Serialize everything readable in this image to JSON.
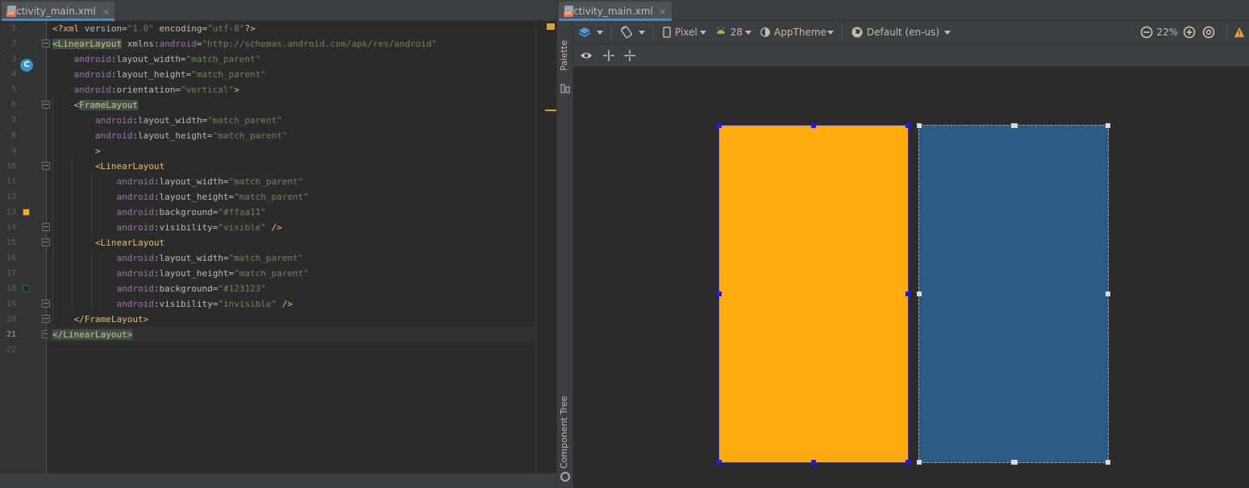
{
  "editor": {
    "tab_label": "activity_main.xml",
    "tab_close": "×",
    "file_icon_tag": "xml",
    "gutter_icon": "C",
    "line_numbers": [
      "1",
      "2",
      "3",
      "4",
      "5",
      "6",
      "7",
      "8",
      "9",
      "10",
      "11",
      "12",
      "13",
      "14",
      "15",
      "16",
      "17",
      "18",
      "19",
      "20",
      "21",
      "22"
    ],
    "current_line": 21,
    "swatch_colors": {
      "line13": "#ffaa11",
      "line18": "#123123"
    },
    "lines": [
      [
        {
          "t": "<?xml ",
          "c": "pi"
        },
        {
          "t": "version=",
          "c": "attr"
        },
        {
          "t": "\"1.0\"",
          "c": "val"
        },
        {
          "t": " encoding=",
          "c": "attr"
        },
        {
          "t": "\"utf-8\"",
          "c": "val"
        },
        {
          "t": "?>",
          "c": "pi"
        }
      ],
      [
        {
          "t": "<LinearLayout",
          "c": "tag",
          "hl": true
        },
        {
          "t": " xmlns:",
          "c": "attr"
        },
        {
          "t": "android",
          "c": "ns"
        },
        {
          "t": "=",
          "c": "attr"
        },
        {
          "t": "\"http://schemas.android.com/apk/res/android\"",
          "c": "val"
        }
      ],
      [
        {
          "t": "    ",
          "c": "attr"
        },
        {
          "t": "android",
          "c": "ns"
        },
        {
          "t": ":layout_width=",
          "c": "attr"
        },
        {
          "t": "\"match_parent\"",
          "c": "val"
        }
      ],
      [
        {
          "t": "    ",
          "c": "attr"
        },
        {
          "t": "android",
          "c": "ns"
        },
        {
          "t": ":layout_height=",
          "c": "attr"
        },
        {
          "t": "\"match_parent\"",
          "c": "val"
        }
      ],
      [
        {
          "t": "    ",
          "c": "attr"
        },
        {
          "t": "android",
          "c": "ns"
        },
        {
          "t": ":orientation=",
          "c": "attr"
        },
        {
          "t": "\"vertical\"",
          "c": "val"
        },
        {
          "t": ">",
          "c": "tag"
        }
      ],
      [
        {
          "t": "    ",
          "c": "attr"
        },
        {
          "t": "<",
          "c": "tag"
        },
        {
          "t": "FrameLayout",
          "c": "tag",
          "hl": true
        }
      ],
      [
        {
          "t": "        ",
          "c": "attr"
        },
        {
          "t": "android",
          "c": "ns"
        },
        {
          "t": ":layout_width=",
          "c": "attr"
        },
        {
          "t": "\"match_parent\"",
          "c": "val"
        }
      ],
      [
        {
          "t": "        ",
          "c": "attr"
        },
        {
          "t": "android",
          "c": "ns"
        },
        {
          "t": ":layout_height=",
          "c": "attr"
        },
        {
          "t": "\"match_parent\"",
          "c": "val"
        }
      ],
      [
        {
          "t": "        ",
          "c": "attr"
        },
        {
          "t": ">",
          "c": "tag"
        }
      ],
      [
        {
          "t": "        ",
          "c": "attr"
        },
        {
          "t": "<LinearLayout",
          "c": "tag"
        }
      ],
      [
        {
          "t": "            ",
          "c": "attr"
        },
        {
          "t": "android",
          "c": "ns"
        },
        {
          "t": ":layout_width=",
          "c": "attr"
        },
        {
          "t": "\"match_parent\"",
          "c": "val"
        }
      ],
      [
        {
          "t": "            ",
          "c": "attr"
        },
        {
          "t": "android",
          "c": "ns"
        },
        {
          "t": ":layout_height=",
          "c": "attr"
        },
        {
          "t": "\"match_parent\"",
          "c": "val"
        }
      ],
      [
        {
          "t": "            ",
          "c": "attr"
        },
        {
          "t": "android",
          "c": "ns"
        },
        {
          "t": ":background=",
          "c": "attr"
        },
        {
          "t": "\"#ffaa11\"",
          "c": "val"
        }
      ],
      [
        {
          "t": "            ",
          "c": "attr"
        },
        {
          "t": "android",
          "c": "ns"
        },
        {
          "t": ":visibility=",
          "c": "attr"
        },
        {
          "t": "\"visible\"",
          "c": "val"
        },
        {
          "t": " />",
          "c": "tag"
        }
      ],
      [
        {
          "t": "        ",
          "c": "attr"
        },
        {
          "t": "<LinearLayout",
          "c": "tag"
        }
      ],
      [
        {
          "t": "            ",
          "c": "attr"
        },
        {
          "t": "android",
          "c": "ns"
        },
        {
          "t": ":layout_width=",
          "c": "attr"
        },
        {
          "t": "\"match_parent\"",
          "c": "val"
        }
      ],
      [
        {
          "t": "            ",
          "c": "attr"
        },
        {
          "t": "android",
          "c": "ns"
        },
        {
          "t": ":layout_height=",
          "c": "attr"
        },
        {
          "t": "\"match_parent\"",
          "c": "val"
        }
      ],
      [
        {
          "t": "            ",
          "c": "attr"
        },
        {
          "t": "android",
          "c": "ns"
        },
        {
          "t": ":background=",
          "c": "attr"
        },
        {
          "t": "\"#123123\"",
          "c": "val"
        }
      ],
      [
        {
          "t": "            ",
          "c": "attr"
        },
        {
          "t": "android",
          "c": "ns"
        },
        {
          "t": ":visibility=",
          "c": "attr"
        },
        {
          "t": "\"invisible\"",
          "c": "val"
        },
        {
          "t": " />",
          "c": "tag"
        }
      ],
      [
        {
          "t": "    ",
          "c": "attr"
        },
        {
          "t": "</FrameLayout>",
          "c": "tag"
        }
      ],
      [
        {
          "t": "</LinearLayout>",
          "c": "tag",
          "hl": true
        }
      ],
      []
    ]
  },
  "designer": {
    "tab_label": "activity_main.xml",
    "tab_close": "×",
    "palette_label": "Palette",
    "component_tree_label": "Component Tree",
    "toolbar": {
      "device": "Pixel",
      "api_level": "28",
      "theme": "AppTheme",
      "locale": "Default (en-us)",
      "zoom": "22%"
    },
    "design_surface_color": "#ffaa11",
    "blueprint_color": "#2a5882"
  }
}
